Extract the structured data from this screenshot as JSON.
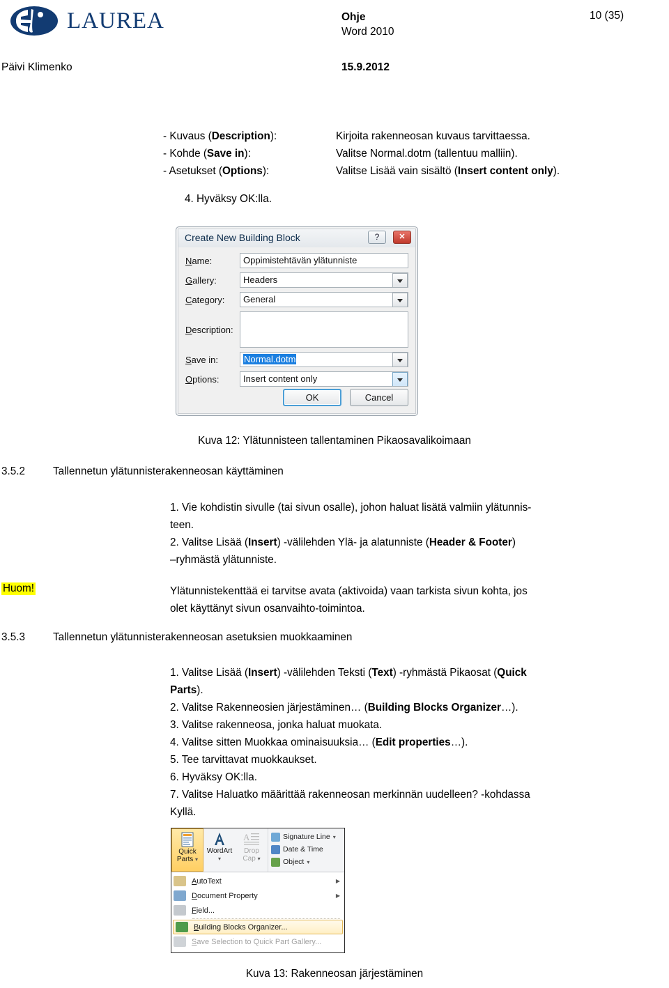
{
  "header": {
    "logo_name": "LAUREA",
    "doc_title": "Ohje",
    "doc_subtitle": "Word 2010",
    "page_number": "10 (35)",
    "author": "Päivi Klimenko",
    "date": "15.9.2012"
  },
  "definitions": [
    {
      "term_plain": "- Kuvaus (",
      "term_bold": "Description",
      "term_tail": "):",
      "desc": "Kirjoita rakenneosan kuvaus tarvittaessa."
    },
    {
      "term_plain": "- Kohde (",
      "term_bold": "Save in",
      "term_tail": "):",
      "desc": "Valitse Normal.dotm (tallentuu malliin)."
    },
    {
      "term_plain": "- Asetukset (",
      "term_bold": "Options",
      "term_tail": "):",
      "desc": "Valitse Lisää vain sisältö (Insert content only)."
    }
  ],
  "step4": "4. Hyväksy OK:lla.",
  "dialog": {
    "title": "Create New Building Block",
    "help_label": "?",
    "close_label": "✕",
    "fields": {
      "name_label": "Name:",
      "name_value": "Oppimistehtävän ylätunniste",
      "gallery_label": "Gallery:",
      "gallery_value": "Headers",
      "category_label": "Category:",
      "category_value": "General",
      "description_label": "Description:",
      "description_value": "",
      "save_in_label": "Save in:",
      "save_in_value": "Normal.dotm",
      "options_label": "Options:",
      "options_value": "Insert content only"
    },
    "ok_label": "OK",
    "cancel_label": "Cancel"
  },
  "caption_12": "Kuva 12: Ylätunnisteen tallentaminen Pikaosavalikoimaan",
  "heading_352": {
    "number": "3.5.2",
    "text": "Tallennetun ylätunnisterakenneosan käyttäminen"
  },
  "list_352_line1": "1. Vie kohdistin sivulle (tai sivun osalle), johon haluat lisätä valmiin ylätunnis-",
  "list_352_line2": "teen.",
  "list_352_line3_a": "2. Valitse Lisää (",
  "list_352_line3_b": "Insert",
  "list_352_line3_c": ") -välilehden Ylä- ja alatunniste (",
  "list_352_line3_d": "Header & Footer",
  "list_352_line3_e": ")",
  "list_352_line4": "–ryhmästä ylätunniste.",
  "huom_label": "Huom!",
  "huom_line1": "Ylätunnistekenttää ei tarvitse avata (aktivoida) vaan tarkista sivun kohta, jos",
  "huom_line2": "olet käyttänyt sivun osanvaihto-toimintoa.",
  "heading_353": {
    "number": "3.5.3",
    "text": "Tallennetun ylätunnisterakenneosan asetuksien muokkaaminen"
  },
  "list_353": {
    "l1a": "1. Valitse Lisää (",
    "l1b": "Insert",
    "l1c": ") -välilehden Teksti (",
    "l1d": "Text",
    "l1e": ") -ryhmästä Pikaosat (",
    "l1f": "Quick",
    "l2a": "Parts",
    "l2b": ").",
    "l3a": "2. Valitse Rakenneosien järjestäminen… (",
    "l3b": "Building Blocks Organizer",
    "l3c": "…).",
    "l4": "3. Valitse rakenneosa, jonka haluat muokata.",
    "l5a": "4. Valitse sitten Muokkaa ominaisuuksia… (",
    "l5b": "Edit properties",
    "l5c": "…).",
    "l6": "5. Tee tarvittavat muokkaukset.",
    "l7": "6. Hyväksy OK:lla.",
    "l8": "7. Valitse Haluatko määrittää rakenneosan merkinnän uudelleen? -kohdassa",
    "l9": "Kyllä."
  },
  "ribbon": {
    "quick_parts_line1": "Quick",
    "quick_parts_line2": "Parts",
    "wordart_label": "WordArt",
    "dropcap_line1": "Drop",
    "dropcap_line2": "Cap",
    "small_buttons": [
      {
        "label": "Signature Line",
        "color": "#6fa8d6",
        "has_dropdown": true
      },
      {
        "label": "Date & Time",
        "color": "#4f86c6",
        "has_dropdown": false
      },
      {
        "label": "Object",
        "color": "#67a24b",
        "has_dropdown": true
      }
    ],
    "menu_items": [
      {
        "label_u": "A",
        "label_rest": "utoText",
        "has_submenu": true,
        "disabled": false,
        "selected": false,
        "icon_color": "#d9c48a"
      },
      {
        "label_u": "D",
        "label_rest": "ocument Property",
        "has_submenu": true,
        "disabled": false,
        "selected": false,
        "icon_color": "#7fa8cf"
      },
      {
        "label_u": "F",
        "label_rest": "ield...",
        "has_submenu": false,
        "disabled": false,
        "selected": false,
        "icon_color": "#b8bec4"
      },
      {
        "label_u": "B",
        "label_rest": "uilding Blocks Organizer...",
        "has_submenu": false,
        "disabled": false,
        "selected": true,
        "icon_color": "#4f9b4a"
      },
      {
        "label_u": "S",
        "label_rest": "ave Selection to Quick Part Gallery...",
        "has_submenu": false,
        "disabled": true,
        "selected": false,
        "icon_color": "#c3c7cb"
      }
    ]
  },
  "caption_13": "Kuva 13: Rakenneosan järjestäminen",
  "colors": {
    "brand_blue": "#123b72",
    "highlight_yellow": "#ffff00",
    "selection_blue": "#1b7fe0",
    "ribbon_amber": "#ffcf63"
  }
}
